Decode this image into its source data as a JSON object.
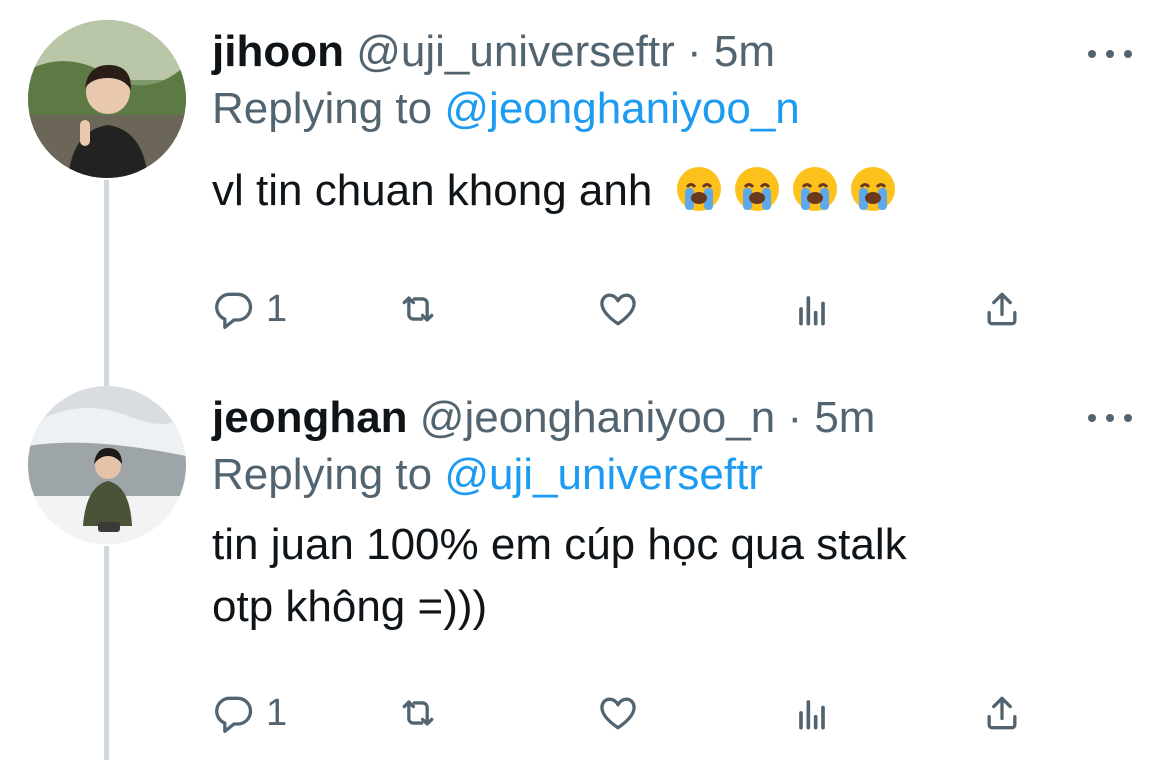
{
  "tweets": [
    {
      "display_name": "jihoon",
      "handle": "@uji_universeftr",
      "separator": "·",
      "time": "5m",
      "replying_prefix": "Replying to",
      "replying_to": "@jeonghaniyoo_n",
      "text": "vl tin chuan khong anh",
      "emoji_count": 4,
      "reply_count": "1"
    },
    {
      "display_name": "jeonghan",
      "handle": "@jeonghaniyoo_n",
      "separator": "·",
      "time": "5m",
      "replying_prefix": "Replying to",
      "replying_to": "@uji_universeftr",
      "text_line_1": "tin juan 100% em cúp học qua stalk",
      "text_line_2": "otp không =)))",
      "reply_count": "1"
    }
  ],
  "icons": {
    "reply": "reply-icon",
    "retweet": "retweet-icon",
    "like": "heart-icon",
    "stats": "analytics-icon",
    "share": "share-icon",
    "more": "more-icon",
    "emoji": "loudly-crying-face-emoji"
  },
  "colors": {
    "link": "#1d9bf0",
    "secondary_text": "#536471",
    "primary_text": "#0f1419",
    "thread_line": "#cfd9de"
  }
}
